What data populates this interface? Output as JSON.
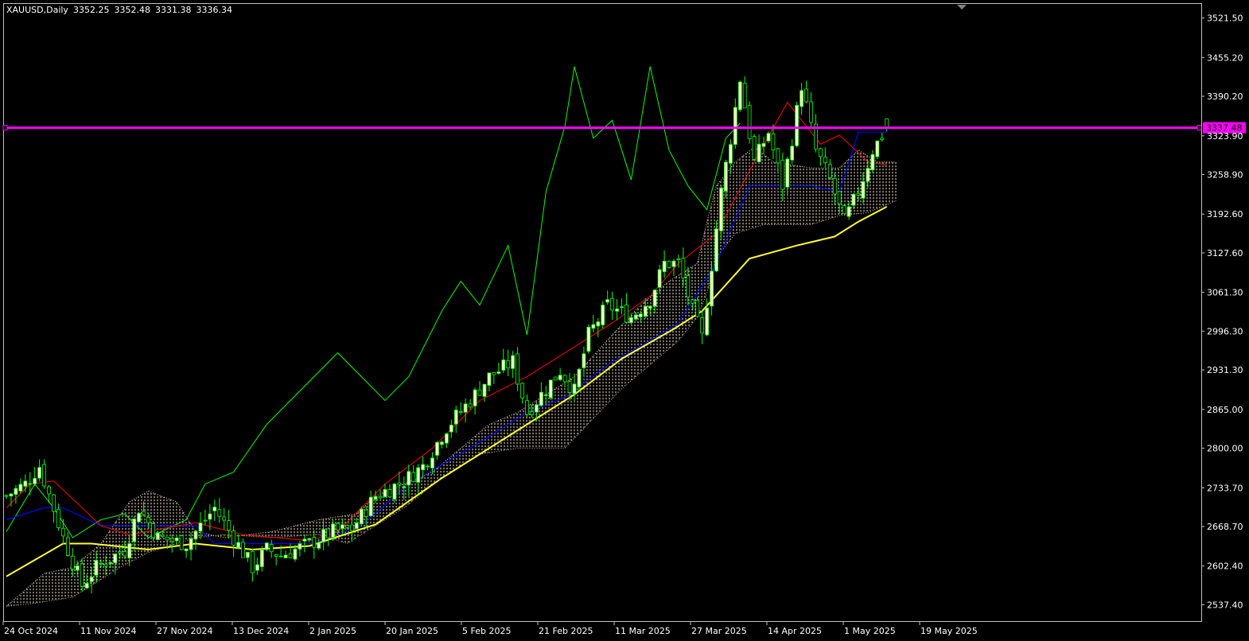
{
  "header": {
    "symbol": "XAUUSD,Daily",
    "open": "3352.25",
    "high": "3352.48",
    "low": "3331.38",
    "close": "3336.34"
  },
  "colors": {
    "background": "#000000",
    "frame": "#c0c0c0",
    "text": "#ffffff",
    "bull_candle": "#ffffcc",
    "bear_candle": "#000000",
    "candle_wick": "#00ff00",
    "tenkan": "#ff0000",
    "kijun": "#0000ff",
    "chikou": "#00ff00",
    "ma": "#ffff33",
    "cloud_bull": "#f0e0c8",
    "cloud_bear": "#d2b48c",
    "price_line": "#ff00ff"
  },
  "chart_data": {
    "type": "candlestick",
    "symbol": "XAUUSD",
    "timeframe": "Daily",
    "ylim": [
      2510,
      3545
    ],
    "y_ticks": [
      "3521.50",
      "3455.20",
      "3390.20",
      "3323.90",
      "3258.90",
      "3192.60",
      "3127.60",
      "3061.30",
      "2996.30",
      "2931.30",
      "2865.00",
      "2800.00",
      "2733.70",
      "2668.70",
      "2602.40",
      "2537.40"
    ],
    "x_ticks": [
      "24 Oct 2024",
      "11 Nov 2024",
      "27 Nov 2024",
      "13 Dec 2024",
      "2 Jan 2025",
      "20 Jan 2025",
      "5 Feb 2025",
      "21 Feb 2025",
      "11 Mar 2025",
      "27 Mar 2025",
      "14 Apr 2025",
      "1 May 2025",
      "19 May 2025"
    ],
    "current_price": "3337.48",
    "candle_anchors": [
      [
        0,
        2720
      ],
      [
        4,
        2740
      ],
      [
        7,
        2770
      ],
      [
        12,
        2650
      ],
      [
        16,
        2570
      ],
      [
        19,
        2600
      ],
      [
        25,
        2630
      ],
      [
        28,
        2700
      ],
      [
        32,
        2650
      ],
      [
        38,
        2640
      ],
      [
        44,
        2700
      ],
      [
        48,
        2650
      ],
      [
        52,
        2600
      ],
      [
        55,
        2630
      ],
      [
        58,
        2620
      ],
      [
        64,
        2640
      ],
      [
        69,
        2660
      ],
      [
        73,
        2665
      ],
      [
        78,
        2720
      ],
      [
        84,
        2745
      ],
      [
        88,
        2770
      ],
      [
        93,
        2835
      ],
      [
        98,
        2880
      ],
      [
        102,
        2920
      ],
      [
        107,
        2945
      ],
      [
        110,
        2860
      ],
      [
        114,
        2900
      ],
      [
        117,
        2930
      ],
      [
        120,
        2895
      ],
      [
        123,
        2990
      ],
      [
        127,
        3040
      ],
      [
        132,
        3020
      ],
      [
        136,
        3050
      ],
      [
        139,
        3110
      ],
      [
        142,
        3110
      ],
      [
        145,
        3030
      ],
      [
        147,
        2985
      ],
      [
        151,
        3230
      ],
      [
        153,
        3320
      ],
      [
        155,
        3420
      ],
      [
        158,
        3280
      ],
      [
        161,
        3330
      ],
      [
        164,
        3240
      ],
      [
        166,
        3320
      ],
      [
        168,
        3410
      ],
      [
        171,
        3300
      ],
      [
        174,
        3250
      ],
      [
        177,
        3180
      ],
      [
        180,
        3230
      ],
      [
        183,
        3300
      ],
      [
        186,
        3336
      ]
    ],
    "ma": [
      [
        0,
        2585
      ],
      [
        12,
        2640
      ],
      [
        18,
        2640
      ],
      [
        30,
        2630
      ],
      [
        40,
        2640
      ],
      [
        52,
        2630
      ],
      [
        64,
        2636
      ],
      [
        78,
        2672
      ],
      [
        92,
        2750
      ],
      [
        106,
        2820
      ],
      [
        120,
        2890
      ],
      [
        130,
        2950
      ],
      [
        141,
        3000
      ],
      [
        147,
        3030
      ],
      [
        157,
        3118
      ],
      [
        167,
        3140
      ],
      [
        175,
        3155
      ],
      [
        180,
        3180
      ],
      [
        186,
        3205
      ]
    ],
    "tenkan": [
      [
        0,
        2700
      ],
      [
        5,
        2740
      ],
      [
        10,
        2745
      ],
      [
        16,
        2700
      ],
      [
        20,
        2670
      ],
      [
        26,
        2655
      ],
      [
        40,
        2675
      ],
      [
        50,
        2655
      ],
      [
        64,
        2645
      ],
      [
        70,
        2660
      ],
      [
        80,
        2740
      ],
      [
        90,
        2800
      ],
      [
        100,
        2880
      ],
      [
        110,
        2920
      ],
      [
        118,
        2960
      ],
      [
        128,
        3010
      ],
      [
        136,
        3055
      ],
      [
        142,
        3110
      ],
      [
        150,
        3160
      ],
      [
        158,
        3280
      ],
      [
        165,
        3380
      ],
      [
        172,
        3310
      ],
      [
        176,
        3325
      ],
      [
        182,
        3280
      ],
      [
        186,
        3275
      ]
    ],
    "kijun": [
      [
        0,
        2680
      ],
      [
        8,
        2700
      ],
      [
        12,
        2700
      ],
      [
        20,
        2670
      ],
      [
        40,
        2670
      ],
      [
        44,
        2640
      ],
      [
        64,
        2640
      ],
      [
        75,
        2670
      ],
      [
        85,
        2740
      ],
      [
        100,
        2810
      ],
      [
        110,
        2860
      ],
      [
        118,
        2885
      ],
      [
        128,
        2945
      ],
      [
        136,
        2980
      ],
      [
        142,
        3010
      ],
      [
        150,
        3110
      ],
      [
        157,
        3240
      ],
      [
        170,
        3240
      ],
      [
        176,
        3230
      ],
      [
        180,
        3330
      ],
      [
        186,
        3330
      ]
    ],
    "chikou": [
      [
        0,
        2660
      ],
      [
        6,
        2740
      ],
      [
        10,
        2700
      ],
      [
        14,
        2650
      ],
      [
        20,
        2680
      ],
      [
        25,
        2690
      ],
      [
        30,
        2650
      ],
      [
        38,
        2680
      ],
      [
        42,
        2740
      ],
      [
        48,
        2760
      ],
      [
        55,
        2840
      ],
      [
        60,
        2880
      ],
      [
        65,
        2920
      ],
      [
        70,
        2960
      ],
      [
        75,
        2920
      ],
      [
        80,
        2880
      ],
      [
        85,
        2920
      ],
      [
        92,
        3030
      ],
      [
        96,
        3080
      ],
      [
        100,
        3040
      ],
      [
        106,
        3140
      ],
      [
        110,
        2990
      ],
      [
        114,
        3230
      ],
      [
        118,
        3340
      ],
      [
        120,
        3440
      ],
      [
        124,
        3320
      ],
      [
        128,
        3350
      ],
      [
        132,
        3250
      ],
      [
        136,
        3440
      ],
      [
        140,
        3300
      ],
      [
        144,
        3240
      ],
      [
        148,
        3200
      ],
      [
        152,
        3320
      ],
      [
        155,
        3345
      ]
    ],
    "senkou_a": [
      [
        0,
        2535
      ],
      [
        8,
        2590
      ],
      [
        14,
        2600
      ],
      [
        20,
        2640
      ],
      [
        26,
        2710
      ],
      [
        30,
        2728
      ],
      [
        36,
        2710
      ],
      [
        40,
        2660
      ],
      [
        46,
        2650
      ],
      [
        56,
        2660
      ],
      [
        66,
        2680
      ],
      [
        74,
        2690
      ],
      [
        78,
        2720
      ],
      [
        84,
        2740
      ],
      [
        90,
        2760
      ],
      [
        96,
        2800
      ],
      [
        102,
        2840
      ],
      [
        108,
        2860
      ],
      [
        114,
        2890
      ],
      [
        120,
        2920
      ],
      [
        128,
        2990
      ],
      [
        134,
        3040
      ],
      [
        140,
        3080
      ],
      [
        146,
        3110
      ],
      [
        148,
        3180
      ],
      [
        150,
        3240
      ],
      [
        154,
        3280
      ],
      [
        158,
        3305
      ],
      [
        162,
        3280
      ],
      [
        170,
        3270
      ],
      [
        176,
        3270
      ],
      [
        180,
        3300
      ],
      [
        184,
        3280
      ],
      [
        188,
        3280
      ]
    ],
    "senkou_b": [
      [
        0,
        2535
      ],
      [
        6,
        2540
      ],
      [
        14,
        2550
      ],
      [
        24,
        2600
      ],
      [
        30,
        2625
      ],
      [
        40,
        2650
      ],
      [
        46,
        2655
      ],
      [
        56,
        2650
      ],
      [
        66,
        2655
      ],
      [
        72,
        2640
      ],
      [
        78,
        2670
      ],
      [
        84,
        2700
      ],
      [
        92,
        2750
      ],
      [
        100,
        2790
      ],
      [
        108,
        2800
      ],
      [
        118,
        2800
      ],
      [
        124,
        2850
      ],
      [
        130,
        2900
      ],
      [
        136,
        2940
      ],
      [
        142,
        2980
      ],
      [
        146,
        3020
      ],
      [
        148,
        3060
      ],
      [
        150,
        3120
      ],
      [
        154,
        3160
      ],
      [
        160,
        3175
      ],
      [
        170,
        3175
      ],
      [
        176,
        3190
      ],
      [
        182,
        3195
      ],
      [
        188,
        3215
      ]
    ]
  }
}
